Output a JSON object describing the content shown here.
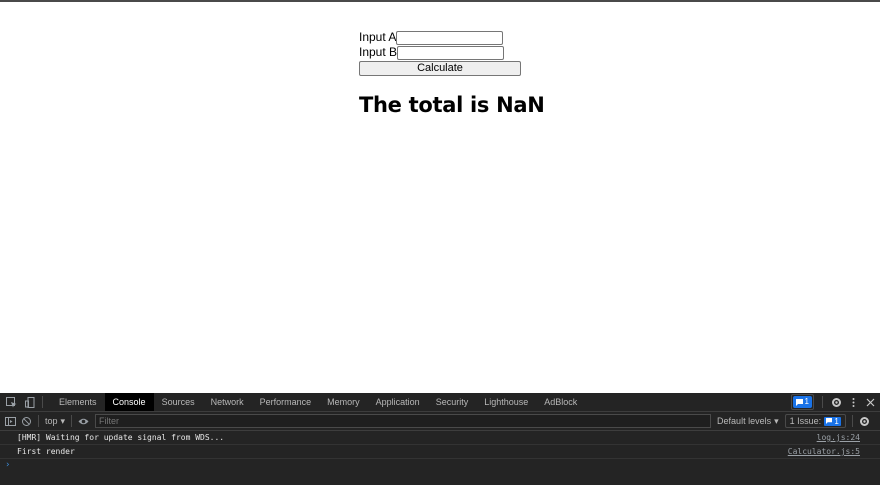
{
  "calculator": {
    "input_a_label": "Input A",
    "input_a_value": "",
    "input_b_label": "Input B",
    "input_b_value": "",
    "button_label": "Calculate",
    "total_text": "The total is NaN"
  },
  "devtools": {
    "tabs": [
      "Elements",
      "Console",
      "Sources",
      "Network",
      "Performance",
      "Memory",
      "Application",
      "Security",
      "Lighthouse",
      "AdBlock"
    ],
    "active_tab": "Console",
    "message_badge_count": "1",
    "toolbar": {
      "context": "top",
      "filter_placeholder": "Filter",
      "levels": "Default levels",
      "issues_label": "1 Issue:",
      "issues_count": "1"
    },
    "logs": [
      {
        "text": "[HMR] Waiting for update signal from WDS...",
        "source": "log.js:24"
      },
      {
        "text": "First render",
        "source": "Calculator.js:5"
      }
    ],
    "prompt_symbol": "›"
  },
  "colors": {
    "devtools_bg": "#242424",
    "active_tab_bg": "#000000",
    "badge_blue": "#1a73e8"
  },
  "icons": [
    "inspect-icon",
    "device-toggle-icon",
    "settings-gear-icon",
    "more-vert-icon",
    "close-icon",
    "sidebar-toggle-icon",
    "clear-console-icon",
    "eye-icon"
  ]
}
